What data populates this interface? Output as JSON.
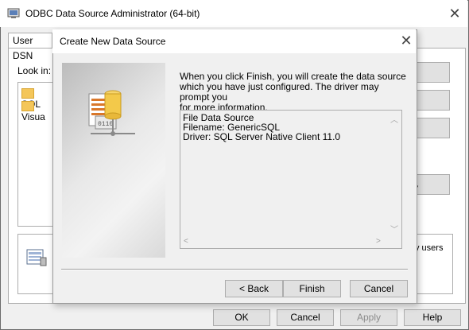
{
  "outer": {
    "title": "ODBC Data Source Administrator (64-bit)",
    "tab_user": "User DSN",
    "look_in_label": "Look in:",
    "folders": [
      "SQL",
      "Visua"
    ],
    "partial_button_label": "y",
    "info_text": "y users",
    "buttons": {
      "ok": "OK",
      "cancel": "Cancel",
      "apply": "Apply",
      "help": "Help"
    }
  },
  "dialog": {
    "title": "Create New Data Source",
    "description_lines": [
      "When you click Finish, you will create the data source",
      "which you have just configured.  The driver may prompt you",
      "for more information."
    ],
    "summary_lines": [
      "File Data Source",
      "Filename:  GenericSQL",
      "Driver:  SQL Server Native Client 11.0"
    ],
    "buttons": {
      "back": "< Back",
      "finish": "Finish",
      "cancel": "Cancel"
    }
  },
  "icons": {
    "app": "odbc-admin-icon",
    "close": "close-icon",
    "wizard": "database-file-icon",
    "info": "odbc-info-icon",
    "folder": "folder-icon"
  }
}
